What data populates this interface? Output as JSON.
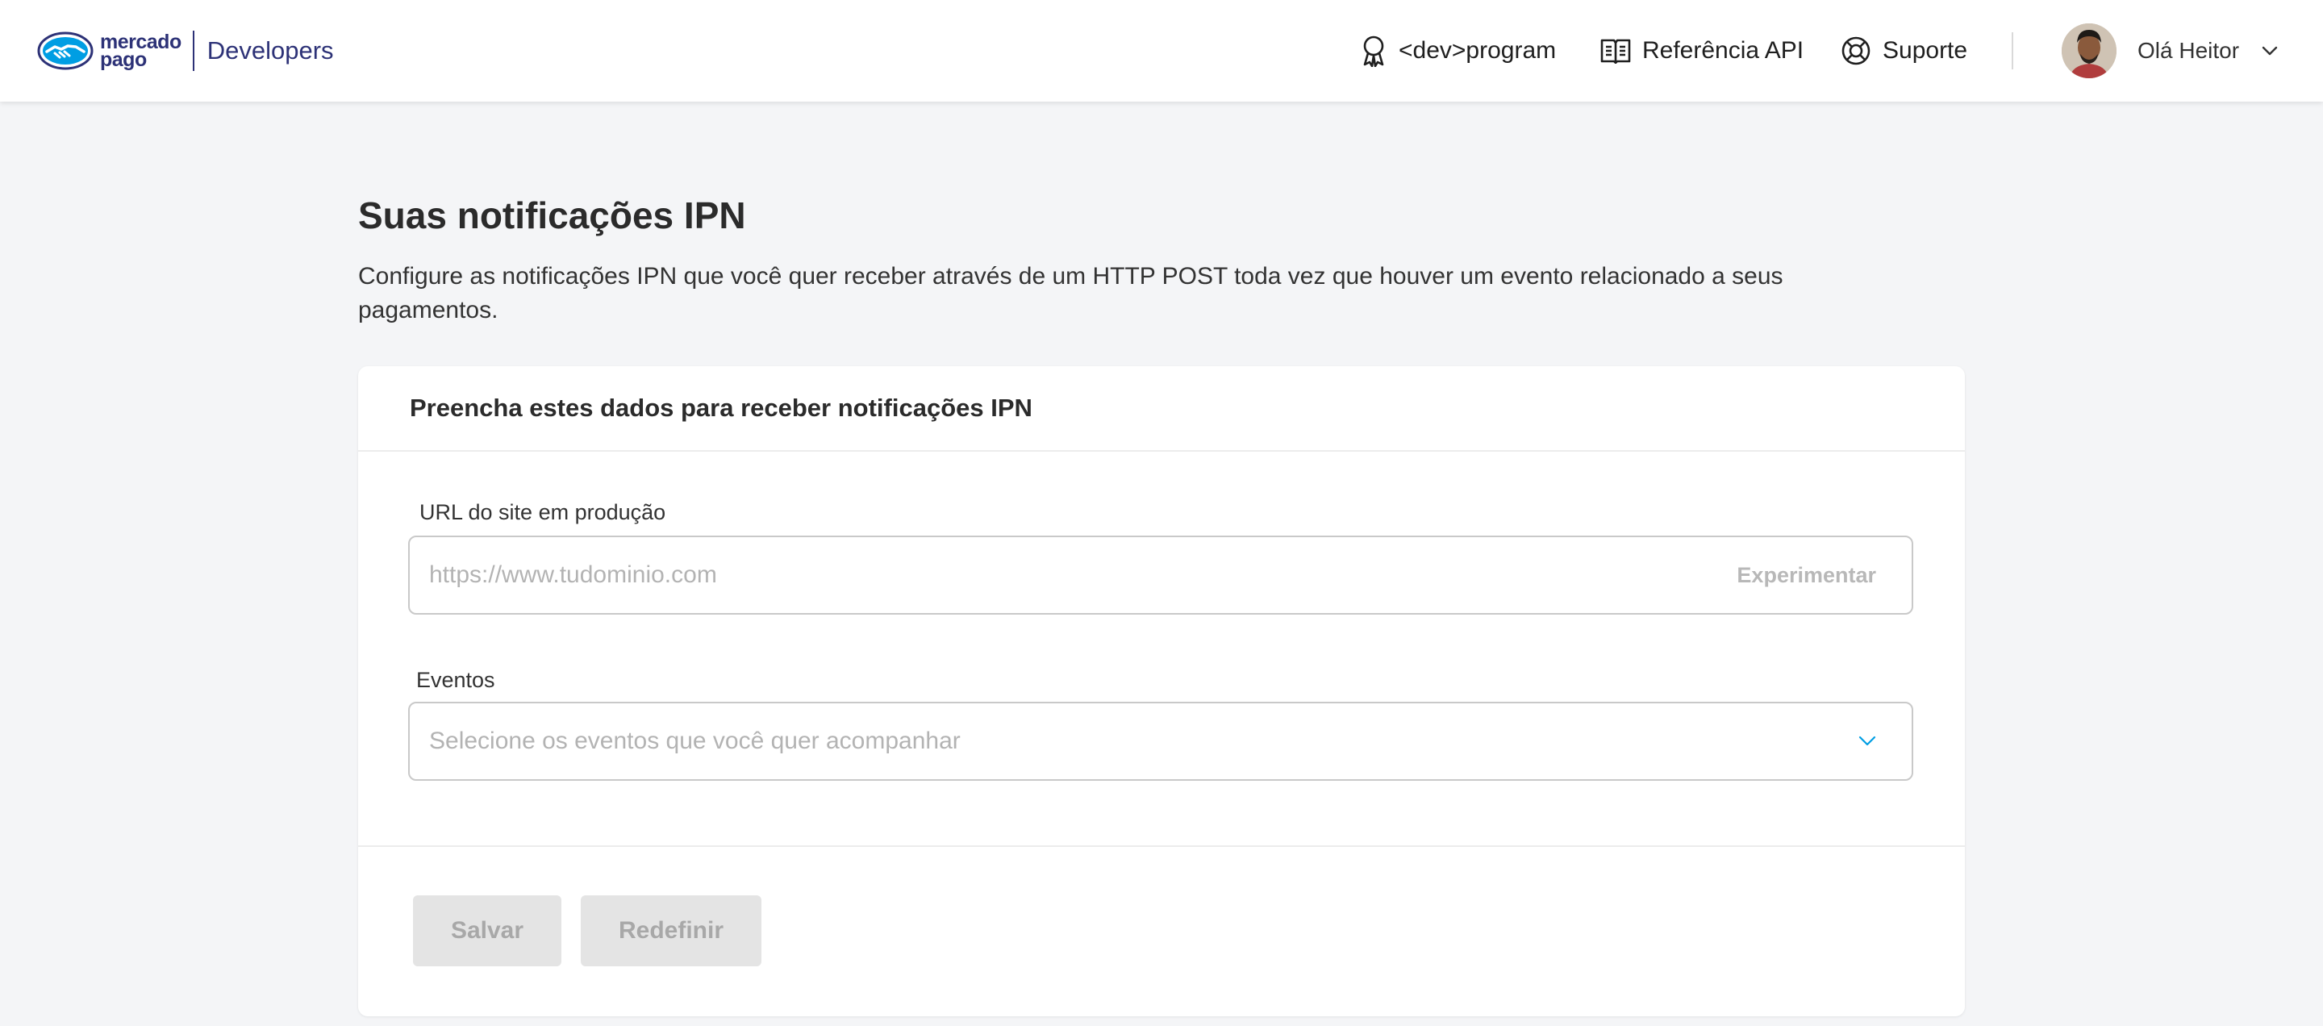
{
  "header": {
    "brand_line1": "mercado",
    "brand_line2": "pago",
    "brand_product": "Developers",
    "nav": [
      {
        "label": "<dev>program",
        "icon": "award-ribbon-icon"
      },
      {
        "label": "Referência API",
        "icon": "book-icon"
      },
      {
        "label": "Suporte",
        "icon": "lifebuoy-icon"
      }
    ],
    "user": {
      "greeting": "Olá Heitor",
      "icon": "chevron-down-icon"
    }
  },
  "main": {
    "title": "Suas notificações IPN",
    "description": "Configure as notificações IPN que você quer receber através de um HTTP POST toda vez que houver um evento relacionado a seus pagamentos.",
    "card": {
      "heading": "Preencha estes dados para receber notificações IPN",
      "url_label": "URL do site em produção",
      "url_placeholder": "https://www.tudominio.com",
      "try_label": "Experimentar",
      "events_label": "Eventos",
      "events_placeholder": "Selecione os eventos que você quer acompanhar",
      "save_label": "Salvar",
      "reset_label": "Redefinir"
    }
  },
  "colors": {
    "brand": "#2d3277",
    "accent": "#009ee3",
    "background": "#f4f5f7",
    "disabled_button": "#e4e4e4"
  }
}
